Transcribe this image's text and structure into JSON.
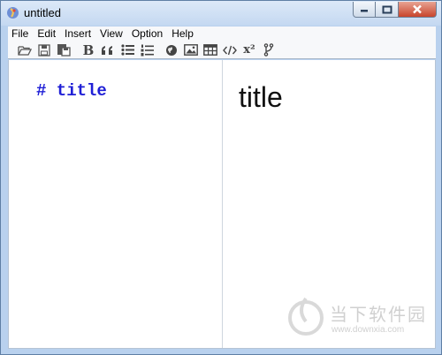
{
  "window": {
    "title": "untitled",
    "controls": [
      "minimize",
      "maximize",
      "close"
    ]
  },
  "menu": {
    "items": [
      "File",
      "Edit",
      "Insert",
      "View",
      "Option",
      "Help"
    ]
  },
  "toolbar": {
    "bold_label": "B",
    "superscript_label": "x²",
    "icons": [
      "open-folder-icon",
      "save-icon",
      "save-as-icon",
      "bold-icon",
      "quote-icon",
      "bullet-list-icon",
      "numbered-list-icon",
      "link-globe-icon",
      "image-icon",
      "table-icon",
      "code-icon",
      "superscript-icon",
      "branch-icon"
    ]
  },
  "editor": {
    "text": "# title"
  },
  "preview": {
    "heading": "title"
  },
  "watermark": {
    "name": "当下软件园",
    "url": "www.downxia.com"
  }
}
